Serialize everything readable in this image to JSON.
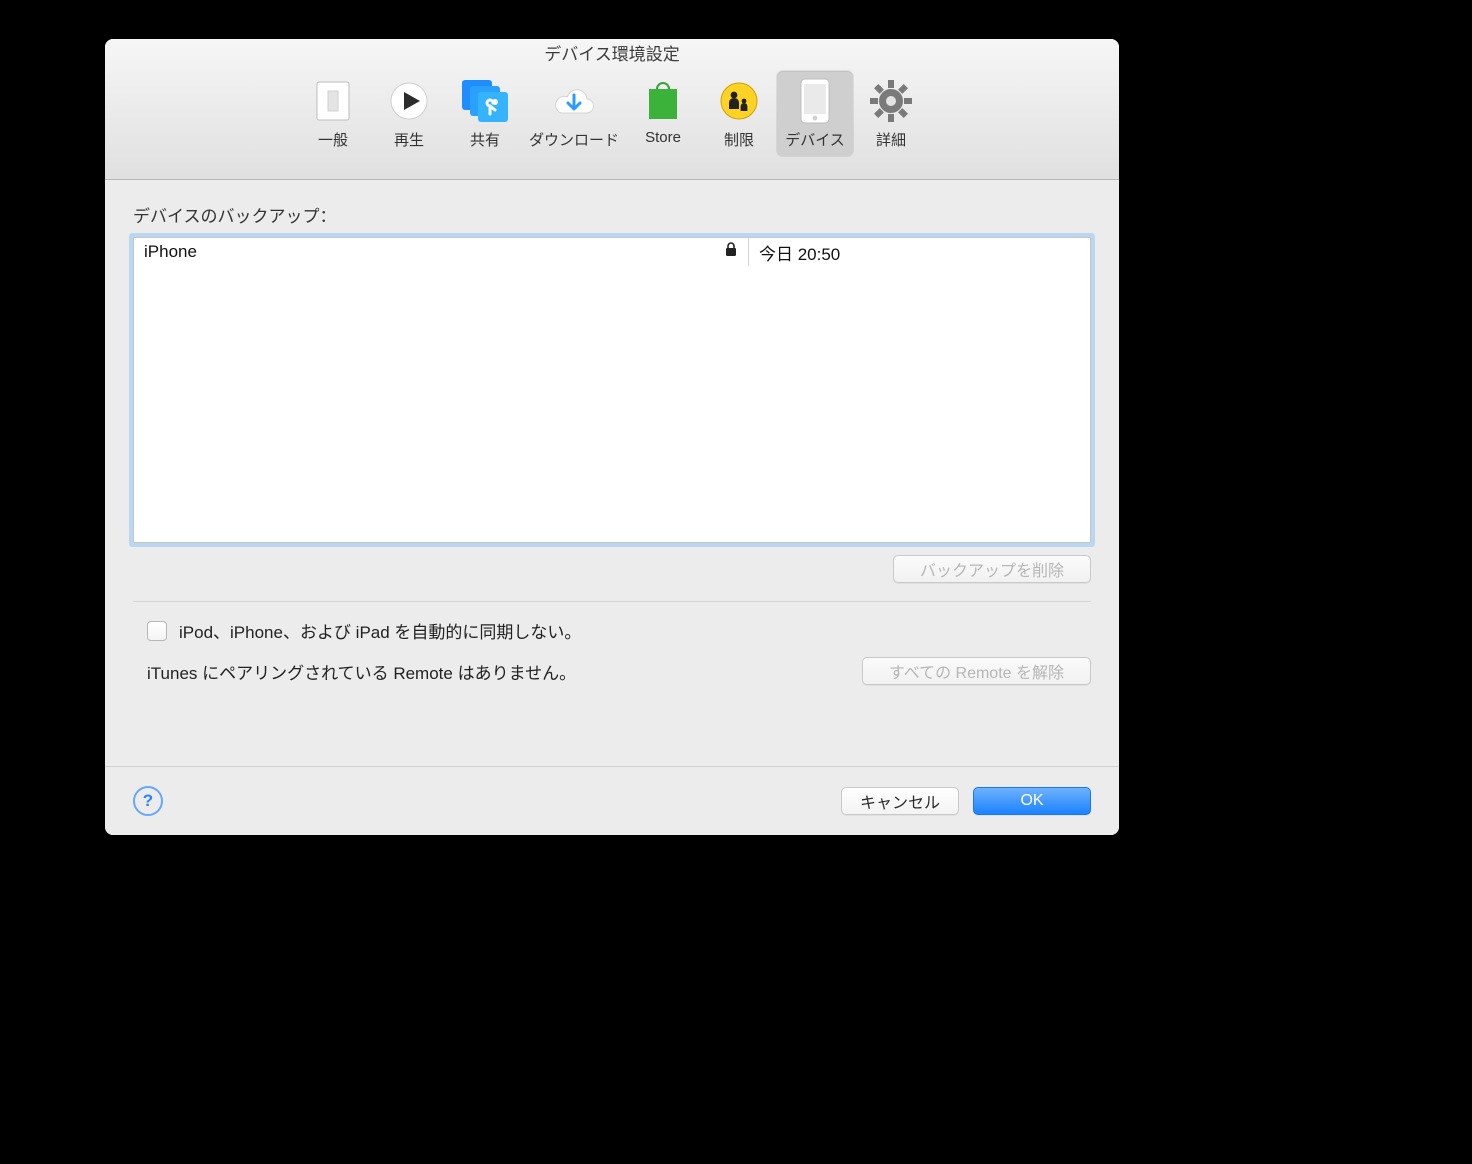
{
  "window": {
    "title": "デバイス環境設定"
  },
  "tabs": {
    "general": "一般",
    "playback": "再生",
    "sharing": "共有",
    "downloads": "ダウンロード",
    "store": "Store",
    "restrict": "制限",
    "devices": "デバイス",
    "advanced": "詳細"
  },
  "backups": {
    "section_label": "デバイスのバックアップ：",
    "items": [
      {
        "name": "iPhone",
        "time": "今日 20:50"
      }
    ],
    "delete_label": "バックアップを削除"
  },
  "options": {
    "no_auto_sync": "iPod、iPhone、および iPad を自動的に同期しない。",
    "remote_status": "iTunes にペアリングされている Remote はありません。",
    "forget_remotes": "すべての Remote を解除"
  },
  "footer": {
    "cancel": "キャンセル",
    "ok": "OK"
  }
}
